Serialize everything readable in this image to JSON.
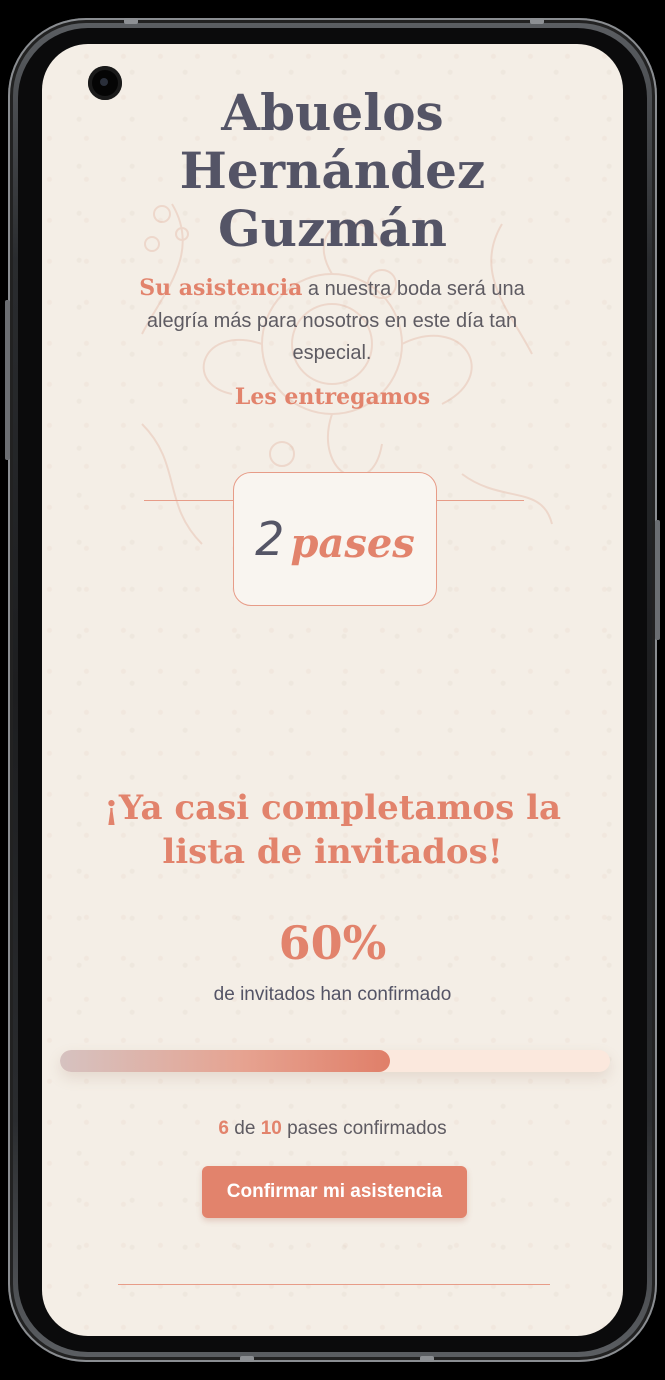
{
  "invite": {
    "family_line1": "Abuelos",
    "family_line2": "Hernández",
    "family_line3": "Guzmán",
    "intro_accent": "Su asistencia",
    "intro_rest": " a nuestra boda será una alegría más para nosotros en este día tan especial.",
    "give_line": "Les entregamos",
    "passes_number": "2",
    "passes_word": "pases"
  },
  "progress": {
    "headline": "¡Ya casi completamos la lista de invitados!",
    "percent_text": "60%",
    "percent_label": "de invitados han confirmado",
    "fraction": 0.6,
    "confirmed": "6",
    "connector": " de ",
    "total": "10",
    "suffix": " pases confirmados"
  },
  "cta": {
    "label": "Confirmar mi asistencia"
  },
  "colors": {
    "accent": "#e2836c",
    "text_dark": "#545466",
    "background": "#f4eee6"
  }
}
